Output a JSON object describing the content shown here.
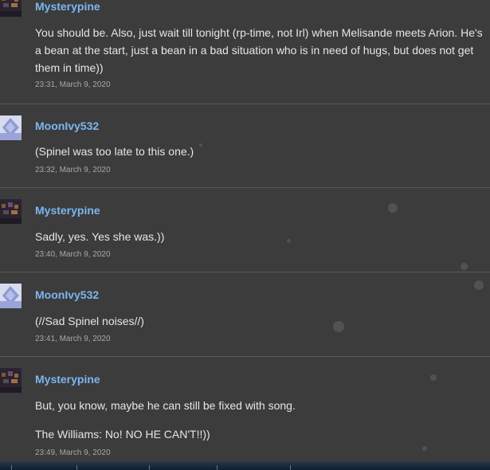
{
  "comments": [
    {
      "author": "Mysterypine",
      "paragraphs": [
        "You should be. Also, just wait till tonight (rp-time, not Irl) when Melisande meets Arion. He's a bean at the start, just a bean in a bad situation who is in need of hugs, but does not get them in time))"
      ],
      "timestamp": "23:31, March 9, 2020"
    },
    {
      "author": "MoonIvy532",
      "paragraphs": [
        "(Spinel was too late to this one.)"
      ],
      "timestamp": "23:32, March 9, 2020"
    },
    {
      "author": "Mysterypine",
      "paragraphs": [
        "Sadly, yes. Yes she was.))"
      ],
      "timestamp": "23:40, March 9, 2020"
    },
    {
      "author": "MoonIvy532",
      "paragraphs": [
        "(//Sad Spinel noises//)"
      ],
      "timestamp": "23:41, March 9, 2020"
    },
    {
      "author": "Mysterypine",
      "paragraphs": [
        "But, you know, maybe he can still be fixed with song.",
        "The Williams: No! NO HE CAN'T!!))"
      ],
      "timestamp": "23:49, March 9, 2020"
    }
  ],
  "colors": {
    "author_link": "#7bb6f1",
    "body_text": "#e6e6e6",
    "timestamp": "#a8a8a8",
    "background": "#3c3c3c"
  }
}
